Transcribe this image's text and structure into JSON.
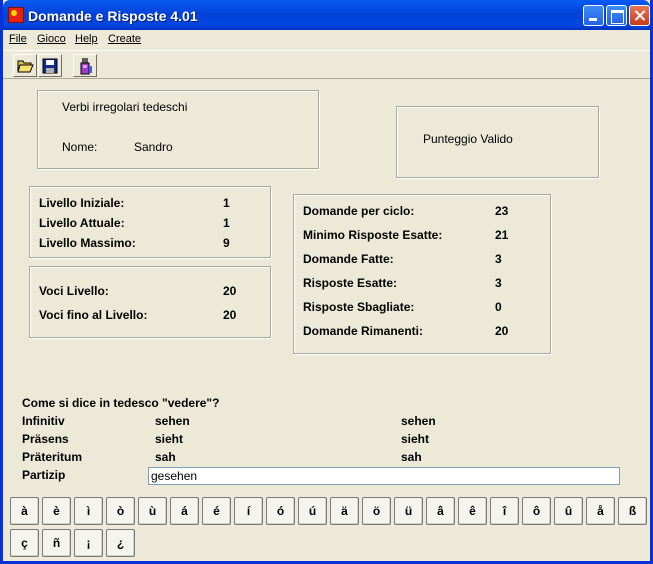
{
  "window": {
    "title": "Domande e Risposte 4.01"
  },
  "menu": [
    "File",
    "Gioco",
    "Help",
    "Create"
  ],
  "toolbar": {
    "icons": [
      "open-folder-icon",
      "save-disk-icon",
      "flask-icon"
    ]
  },
  "info": {
    "topic": "Verbi irregolari tedeschi",
    "name_label": "Nome:",
    "name_value": "Sandro"
  },
  "score": {
    "label": "Punteggio Valido"
  },
  "levels": [
    {
      "label": "Livello Iniziale:",
      "value": "1"
    },
    {
      "label": "Livello Attuale:",
      "value": "1"
    },
    {
      "label": "Livello Massimo:",
      "value": "9"
    }
  ],
  "voci": [
    {
      "label": "Voci Livello:",
      "value": "20"
    },
    {
      "label": "Voci fino al Livello:",
      "value": "20"
    }
  ],
  "stats": [
    {
      "label": "Domande per ciclo:",
      "value": "23"
    },
    {
      "label": "Minimo Risposte Esatte:",
      "value": "21"
    },
    {
      "label": "Domande Fatte:",
      "value": "3"
    },
    {
      "label": "Risposte Esatte:",
      "value": "3"
    },
    {
      "label": "Risposte Sbagliate:",
      "value": "0"
    },
    {
      "label": "Domande Rimanenti:",
      "value": "20"
    }
  ],
  "question": {
    "text": "Come si dice in tedesco \"vedere\"?",
    "rows": [
      {
        "label": "Infinitiv",
        "answer": "sehen",
        "correct": "sehen"
      },
      {
        "label": "Präsens",
        "answer": "sieht",
        "correct": "sieht"
      },
      {
        "label": "Präteritum",
        "answer": "sah",
        "correct": "sah"
      }
    ],
    "last_label": "Partizip",
    "input_value": "gesehen"
  },
  "special_chars": [
    "à",
    "è",
    "ì",
    "ò",
    "ù",
    "á",
    "é",
    "í",
    "ó",
    "ú",
    "ä",
    "ö",
    "ü",
    "â",
    "ê",
    "î",
    "ô",
    "û",
    "å",
    "ß",
    "ç",
    "ñ",
    "¡",
    "¿"
  ]
}
